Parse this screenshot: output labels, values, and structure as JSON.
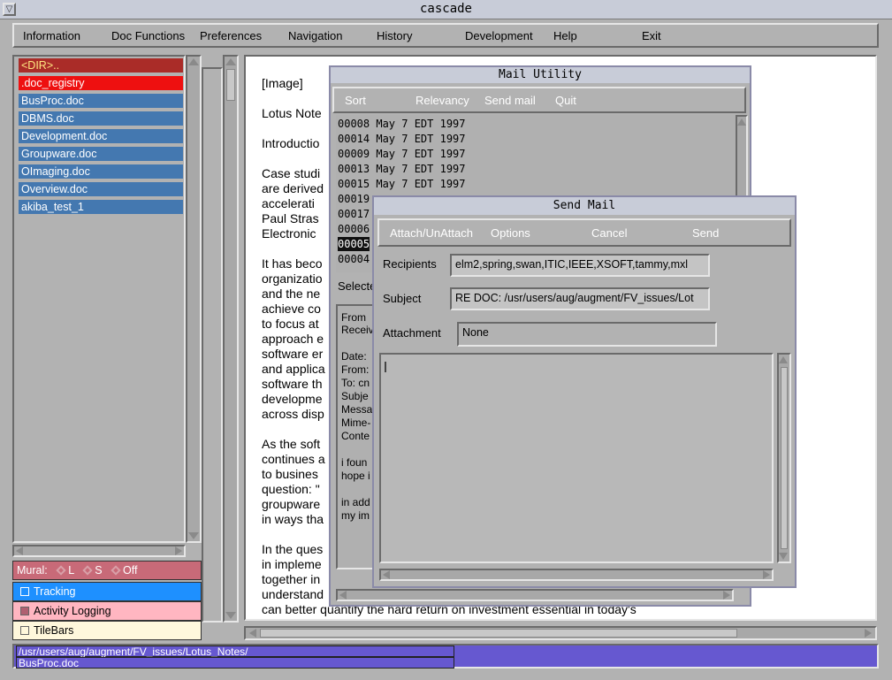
{
  "window": {
    "title": "cascade"
  },
  "menubar": [
    "Information",
    "Doc Functions",
    "Preferences",
    "Navigation",
    "History",
    "Development",
    "Help",
    "Exit"
  ],
  "files": [
    {
      "label": "<DIR>..",
      "kind": "dir"
    },
    {
      "label": ".doc_registry",
      "kind": "reg"
    },
    {
      "label": "BusProc.doc",
      "kind": "doc"
    },
    {
      "label": "DBMS.doc",
      "kind": "doc"
    },
    {
      "label": "Development.doc",
      "kind": "doc"
    },
    {
      "label": "Groupware.doc",
      "kind": "doc"
    },
    {
      "label": "OImaging.doc",
      "kind": "doc"
    },
    {
      "label": "Overview.doc",
      "kind": "doc"
    },
    {
      "label": "akiba_test_1",
      "kind": "doc"
    }
  ],
  "panel": {
    "mural_label": "Mural:",
    "mural_options": [
      "L",
      "S",
      "Off"
    ],
    "tracking": "Tracking",
    "activity_logging": "Activity Logging",
    "tilebars": "TileBars",
    "colors": {
      "mural": "#c86a78",
      "tracking": "#1e90ff",
      "activity": "#ffb6c1",
      "tilebars": "#fff8dc"
    }
  },
  "document": {
    "lines": [
      "[Image]",
      "Lotus Note",
      "Introductio",
      "Case studi",
      "are derived",
      "accelerati",
      " Paul Stras",
      "Electronic",
      "It has beco",
      "organizatio",
      "and the ne",
      "achieve co",
      "to focus at",
      "approach e",
      "software er",
      "and applica",
      "software th",
      "developme",
      "across disp",
      "As the soft",
      "continues a",
      "to busines",
      "question: \"",
      "groupware",
      "in ways tha",
      "In the ques",
      "in impleme",
      "together in",
      "understand",
      "can better quantify the hard return on investment essential in today's"
    ]
  },
  "status": {
    "path_line1": "/usr/users/aug/augment/FV_issues/Lotus_Notes/",
    "path_line2": "BusProc.doc"
  },
  "mail_utility": {
    "title": "Mail Utility",
    "toolbar": [
      "Sort",
      "Relevancy",
      "Send mail",
      "Quit"
    ],
    "messages": [
      "00008 May 7 EDT 1997",
      "00014 May 7 EDT 1997",
      "00009 May 7 EDT 1997",
      "00013 May 7 EDT 1997",
      "00015 May 7 EDT 1997",
      "00019",
      "00017",
      "00006",
      "00005",
      "00004"
    ],
    "selected_index": 8,
    "selected_label": "Selecte",
    "body_lines": [
      "From",
      "Receiv",
      "Date:",
      "From:",
      "To: cn",
      "Subje",
      "Messa",
      "Mime-",
      "Conte",
      "i foun",
      "hope i",
      "in add",
      "my im"
    ]
  },
  "send_mail": {
    "title": "Send Mail",
    "toolbar": [
      "Attach/UnAttach",
      "Options",
      "Cancel",
      "Send"
    ],
    "recipients_label": "Recipients",
    "recipients_value": "elm2,spring,swan,ITIC,IEEE,XSOFT,tammy,mxl",
    "subject_label": "Subject",
    "subject_value": "RE DOC: /usr/users/aug/augment/FV_issues/Lot",
    "attachment_label": "Attachment",
    "attachment_value": "None"
  }
}
